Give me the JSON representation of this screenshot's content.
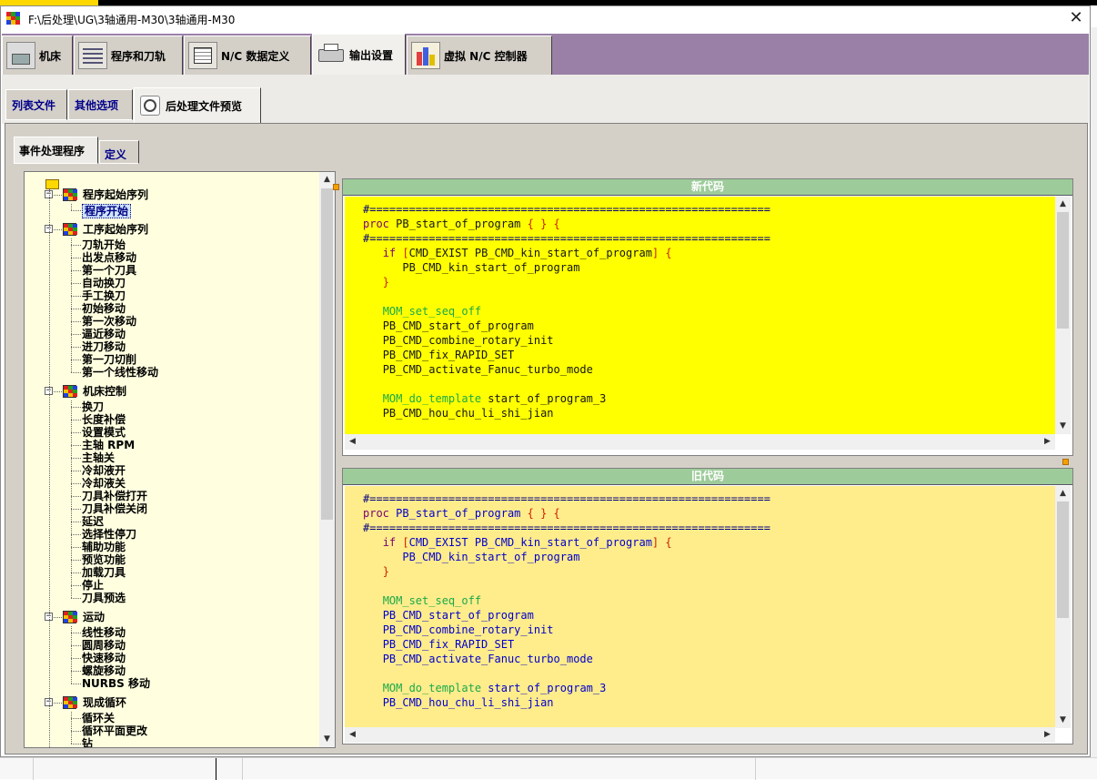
{
  "window": {
    "title": "F:\\后处理\\UG\\3轴通用-M30\\3轴通用-M30",
    "close_glyph": "✕"
  },
  "main_tabs": [
    {
      "label": "机床",
      "icon": "machine-icon"
    },
    {
      "label": "程序和刀轨",
      "icon": "program-icon"
    },
    {
      "label": "N/C 数据定义",
      "icon": "nc-data-icon"
    },
    {
      "label": "输出设置",
      "icon": "printer-icon"
    },
    {
      "label": "虚拟 N/C 控制器",
      "icon": "controller-icon"
    }
  ],
  "sub_tabs": [
    {
      "label": "列表文件"
    },
    {
      "label": "其他选项"
    },
    {
      "label": "后处理文件预览",
      "icon": "magnifier-icon"
    }
  ],
  "tree_tabs": [
    {
      "label": "事件处理程序"
    },
    {
      "label": "定义"
    }
  ],
  "tree": {
    "groups": [
      {
        "label": "程序起始序列",
        "items": [
          "程序开始"
        ]
      },
      {
        "label": "工序起始序列",
        "items": [
          "刀轨开始",
          "出发点移动",
          "第一个刀具",
          "自动换刀",
          "手工换刀",
          "初始移动",
          "第一次移动",
          "逼近移动",
          "进刀移动",
          "第一刀切削",
          "第一个线性移动"
        ]
      },
      {
        "label": "机床控制",
        "items": [
          "换刀",
          "长度补偿",
          "设置模式",
          "主轴 RPM",
          "主轴关",
          "冷却液开",
          "冷却液关",
          "刀具补偿打开",
          "刀具补偿关闭",
          "延迟",
          "选择性停刀",
          "辅助功能",
          "预览功能",
          "加载刀具",
          "停止",
          "刀具预选"
        ]
      },
      {
        "label": "运动",
        "items": [
          "线性移动",
          "圆周移动",
          "快速移动",
          "螺旋移动",
          "NURBS 移动"
        ]
      },
      {
        "label": "现成循环",
        "items": [
          "循环关",
          "循环平面更改",
          "钻"
        ]
      }
    ],
    "selected": "程序开始"
  },
  "new_code": {
    "header": "新代码",
    "lines": [
      "#=============================================================",
      "proc PB_start_of_program { } {",
      "#=============================================================",
      "   if [CMD_EXIST PB_CMD_kin_start_of_program] {",
      "      PB_CMD_kin_start_of_program",
      "   }",
      "",
      "   MOM_set_seq_off",
      "   PB_CMD_start_of_program",
      "   PB_CMD_combine_rotary_init",
      "   PB_CMD_fix_RAPID_SET",
      "   PB_CMD_activate_Fanuc_turbo_mode",
      "",
      "   MOM_do_template start_of_program_3",
      "   PB_CMD_hou_chu_li_shi_jian"
    ]
  },
  "old_code": {
    "header": "旧代码",
    "lines": [
      "#=============================================================",
      "proc PB_start_of_program { } {",
      "#=============================================================",
      "   if [CMD_EXIST PB_CMD_kin_start_of_program] {",
      "      PB_CMD_kin_start_of_program",
      "   }",
      "",
      "   MOM_set_seq_off",
      "   PB_CMD_start_of_program",
      "   PB_CMD_combine_rotary_init",
      "   PB_CMD_fix_RAPID_SET",
      "   PB_CMD_activate_Fanuc_turbo_mode",
      "",
      "   MOM_do_template start_of_program_3",
      "   PB_CMD_hou_chu_li_shi_jian"
    ]
  },
  "colors": {
    "new_bg": "#ffff00",
    "old_bg": "#ffec8b",
    "tab_strip": "#9a7fa6",
    "tree_bg": "#ffffe0",
    "code_header": "#9dcc9a"
  }
}
